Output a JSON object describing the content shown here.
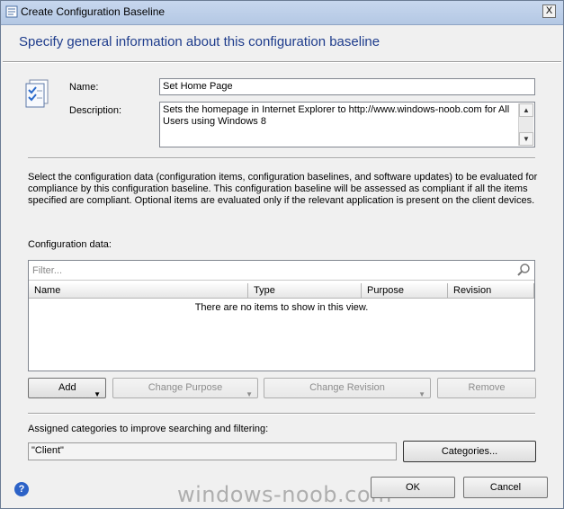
{
  "window": {
    "title": "Create Configuration Baseline",
    "close_label": "X"
  },
  "header": {
    "heading": "Specify general information about this configuration baseline"
  },
  "form": {
    "name_label": "Name:",
    "name_value": "Set Home Page",
    "description_label": "Description:",
    "description_value": "Sets the homepage in Internet Explorer to http://www.windows-noob.com for All Users using Windows 8"
  },
  "info_text": "Select the configuration data (configuration items, configuration baselines, and software updates) to be evaluated for compliance by this configuration baseline. This configuration baseline will be assessed as compliant if all the items specified are compliant. Optional items are evaluated only if the relevant application is present on  the client devices.",
  "config_data": {
    "label": "Configuration data:",
    "filter_placeholder": "Filter...",
    "columns": [
      "Name",
      "Type",
      "Purpose",
      "Revision"
    ],
    "empty_message": "There are no items to show in this view."
  },
  "actions": {
    "add": "Add",
    "change_purpose": "Change Purpose",
    "change_revision": "Change Revision",
    "remove": "Remove"
  },
  "categories": {
    "label": "Assigned categories to improve searching and filtering:",
    "value": "\"Client\"",
    "button": "Categories..."
  },
  "footer": {
    "ok": "OK",
    "cancel": "Cancel",
    "help_icon": "?",
    "watermark": "windows-noob.com"
  }
}
